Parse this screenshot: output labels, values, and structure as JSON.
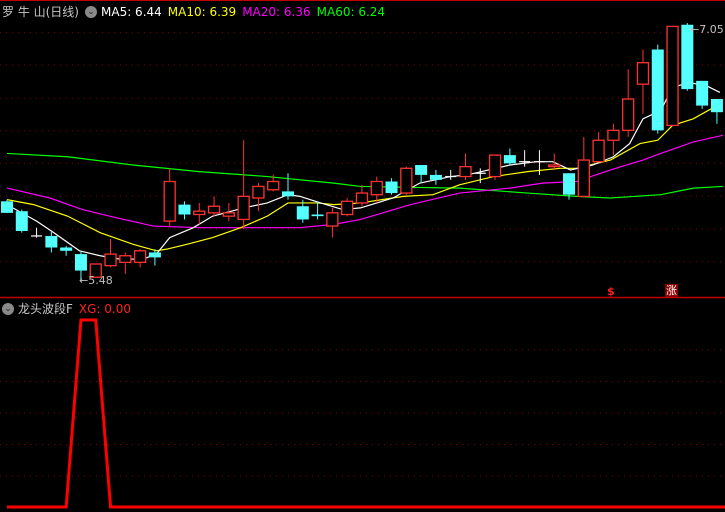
{
  "header": {
    "stock_name": "罗 牛 山(日线)",
    "ma5": "MA5: 6.44",
    "ma10": "MA10: 6.39",
    "ma20": "MA20: 6.36",
    "ma60": "MA60: 6.24",
    "menu_icon": "chevron-down-circle-icon"
  },
  "indicator_header": {
    "name": "龙头波段F",
    "xg": "XG: 0.00",
    "menu_icon": "chevron-down-circle-icon"
  },
  "annotations": {
    "low_label": "←5.48",
    "high_label": "←7.05",
    "signal_dollar": "$",
    "signal_zhang": "涨"
  },
  "colors": {
    "up": "#ff3232",
    "down": "#54ffff",
    "doji": "#ffffff",
    "ma5": "#ffffff",
    "ma10": "#ffff00",
    "ma20": "#ff00ff",
    "ma60": "#00ff00",
    "xg": "#ff0000",
    "grid": "#8b0000",
    "divider": "#c00000"
  },
  "chart_data": [
    {
      "type": "candlestick",
      "ylim": [
        5.39,
        7.19
      ],
      "grid": true,
      "ohlc": [
        [
          5.97,
          5.98,
          5.9,
          5.9
        ],
        [
          5.91,
          5.92,
          5.78,
          5.79
        ],
        [
          5.76,
          5.81,
          5.75,
          5.76
        ],
        [
          5.76,
          5.79,
          5.66,
          5.69
        ],
        [
          5.69,
          5.7,
          5.64,
          5.67
        ],
        [
          5.65,
          5.67,
          5.48,
          5.55
        ],
        [
          5.51,
          5.59,
          5.51,
          5.59
        ],
        [
          5.58,
          5.74,
          5.57,
          5.65
        ],
        [
          5.6,
          5.66,
          5.53,
          5.64
        ],
        [
          5.6,
          5.68,
          5.57,
          5.67
        ],
        [
          5.66,
          5.68,
          5.58,
          5.63
        ],
        [
          5.85,
          6.17,
          5.82,
          6.09
        ],
        [
          5.95,
          5.97,
          5.86,
          5.89
        ],
        [
          5.89,
          5.96,
          5.83,
          5.91
        ],
        [
          5.9,
          6.0,
          5.88,
          5.94
        ],
        [
          5.88,
          5.96,
          5.85,
          5.9
        ],
        [
          5.86,
          6.34,
          5.8,
          6.0
        ],
        [
          5.99,
          6.08,
          5.91,
          6.06
        ],
        [
          6.04,
          6.13,
          6.03,
          6.09
        ],
        [
          6.03,
          6.14,
          5.98,
          6.0
        ],
        [
          5.94,
          5.98,
          5.84,
          5.86
        ],
        [
          5.89,
          5.97,
          5.86,
          5.88
        ],
        [
          5.82,
          5.93,
          5.75,
          5.9
        ],
        [
          5.89,
          5.99,
          5.88,
          5.97
        ],
        [
          5.96,
          6.07,
          5.94,
          6.02
        ],
        [
          6.01,
          6.12,
          5.96,
          6.09
        ],
        [
          6.09,
          6.11,
          6.01,
          6.02
        ],
        [
          6.02,
          6.18,
          6.01,
          6.17
        ],
        [
          6.19,
          6.19,
          6.08,
          6.13
        ],
        [
          6.13,
          6.16,
          6.07,
          6.1
        ],
        [
          6.12,
          6.16,
          6.1,
          6.12
        ],
        [
          6.12,
          6.26,
          6.1,
          6.18
        ],
        [
          6.14,
          6.17,
          6.08,
          6.14
        ],
        [
          6.12,
          6.25,
          6.1,
          6.25
        ],
        [
          6.25,
          6.29,
          6.19,
          6.2
        ],
        [
          6.21,
          6.28,
          6.18,
          6.21
        ],
        [
          6.21,
          6.28,
          6.13,
          6.21
        ],
        [
          6.18,
          6.26,
          6.16,
          6.19
        ],
        [
          6.14,
          6.14,
          5.98,
          6.01
        ],
        [
          6.0,
          6.36,
          6.0,
          6.22
        ],
        [
          6.21,
          6.39,
          6.21,
          6.34
        ],
        [
          6.34,
          6.44,
          6.25,
          6.4
        ],
        [
          6.4,
          6.77,
          6.36,
          6.59
        ],
        [
          6.68,
          6.89,
          6.5,
          6.81
        ],
        [
          6.89,
          6.92,
          6.38,
          6.4
        ],
        [
          6.43,
          7.03,
          6.43,
          7.03
        ],
        [
          7.04,
          7.05,
          6.64,
          6.65
        ],
        [
          6.7,
          6.7,
          6.53,
          6.55
        ],
        [
          6.59,
          6.59,
          6.44,
          6.51
        ]
      ],
      "ma5": [
        [
          0,
          5.95
        ],
        [
          1,
          5.9
        ],
        [
          2,
          5.85
        ],
        [
          3,
          5.79
        ],
        [
          4.9,
          5.67
        ],
        [
          6.3,
          5.64
        ],
        [
          7.6,
          5.62
        ],
        [
          9.2,
          5.62
        ],
        [
          10.1,
          5.65
        ],
        [
          11,
          5.75
        ],
        [
          12.6,
          5.81
        ],
        [
          13.9,
          5.88
        ],
        [
          16,
          5.93
        ],
        [
          17.6,
          5.96
        ],
        [
          19,
          6.01
        ],
        [
          19.8,
          6.0
        ],
        [
          21.2,
          5.96
        ],
        [
          22.7,
          5.92
        ],
        [
          23.9,
          5.93
        ],
        [
          26.1,
          5.99
        ],
        [
          27.9,
          6.08
        ],
        [
          30,
          6.12
        ],
        [
          31.1,
          6.13
        ],
        [
          34,
          6.19
        ],
        [
          35.8,
          6.21
        ],
        [
          36.9,
          6.21
        ],
        [
          38.1,
          6.16
        ],
        [
          39.6,
          6.19
        ],
        [
          41,
          6.24
        ],
        [
          42.1,
          6.32
        ],
        [
          43,
          6.47
        ],
        [
          44.2,
          6.52
        ],
        [
          45,
          6.66
        ],
        [
          46.1,
          6.69
        ],
        [
          47.3,
          6.67
        ],
        [
          48.2,
          6.63
        ]
      ],
      "ma10": [
        [
          0,
          5.98
        ],
        [
          1.8,
          5.95
        ],
        [
          4.1,
          5.88
        ],
        [
          6.3,
          5.78
        ],
        [
          8.5,
          5.71
        ],
        [
          10.1,
          5.67
        ],
        [
          10.8,
          5.68
        ],
        [
          12.2,
          5.71
        ],
        [
          13.9,
          5.75
        ],
        [
          15.8,
          5.81
        ],
        [
          17.6,
          5.88
        ],
        [
          19,
          5.96
        ],
        [
          21,
          5.96
        ],
        [
          22.1,
          5.95
        ],
        [
          23.9,
          5.96
        ],
        [
          26.8,
          6.0
        ],
        [
          28.8,
          6.01
        ],
        [
          30.6,
          6.07
        ],
        [
          32.9,
          6.12
        ],
        [
          35.2,
          6.15
        ],
        [
          37.4,
          6.17
        ],
        [
          38.5,
          6.17
        ],
        [
          40.8,
          6.22
        ],
        [
          42.8,
          6.32
        ],
        [
          44,
          6.34
        ],
        [
          45,
          6.43
        ],
        [
          46.4,
          6.47
        ],
        [
          48.4,
          6.57
        ]
      ],
      "ma20": [
        [
          0,
          6.05
        ],
        [
          2.9,
          5.99
        ],
        [
          5.1,
          5.92
        ],
        [
          7.4,
          5.87
        ],
        [
          9.9,
          5.82
        ],
        [
          13.1,
          5.81
        ],
        [
          16.4,
          5.81
        ],
        [
          19.8,
          5.81
        ],
        [
          22.1,
          5.83
        ],
        [
          23.9,
          5.86
        ],
        [
          27.3,
          5.95
        ],
        [
          30.6,
          6.02
        ],
        [
          34,
          6.05
        ],
        [
          36.2,
          6.08
        ],
        [
          38.5,
          6.09
        ],
        [
          40.8,
          6.16
        ],
        [
          43,
          6.22
        ],
        [
          44.2,
          6.26
        ],
        [
          46.4,
          6.33
        ],
        [
          48.4,
          6.37
        ]
      ],
      "ma60": [
        [
          0,
          6.26
        ],
        [
          4.1,
          6.24
        ],
        [
          8.5,
          6.19
        ],
        [
          13,
          6.15
        ],
        [
          17.6,
          6.12
        ],
        [
          22.1,
          6.08
        ],
        [
          23.9,
          6.06
        ],
        [
          30.6,
          6.05
        ],
        [
          35.2,
          6.02
        ],
        [
          38.5,
          6.0
        ],
        [
          40.8,
          5.99
        ],
        [
          44.2,
          6.01
        ],
        [
          46.4,
          6.05
        ],
        [
          48.4,
          6.06
        ]
      ],
      "signals": [
        {
          "index": 41,
          "label_key": "signal_dollar"
        },
        {
          "index": 45,
          "label_key": "signal_zhang"
        }
      ]
    },
    {
      "type": "line",
      "name": "XG",
      "ylim": [
        0,
        1
      ],
      "values": [
        0,
        0,
        0,
        0,
        0,
        1,
        1,
        0,
        0,
        0,
        0,
        0,
        0,
        0,
        0,
        0,
        0,
        0,
        0,
        0,
        0,
        0,
        0,
        0,
        0,
        0,
        0,
        0,
        0,
        0,
        0,
        0,
        0,
        0,
        0,
        0,
        0,
        0,
        0,
        0,
        0,
        0,
        0,
        0,
        0,
        0,
        0,
        0,
        0
      ]
    }
  ]
}
